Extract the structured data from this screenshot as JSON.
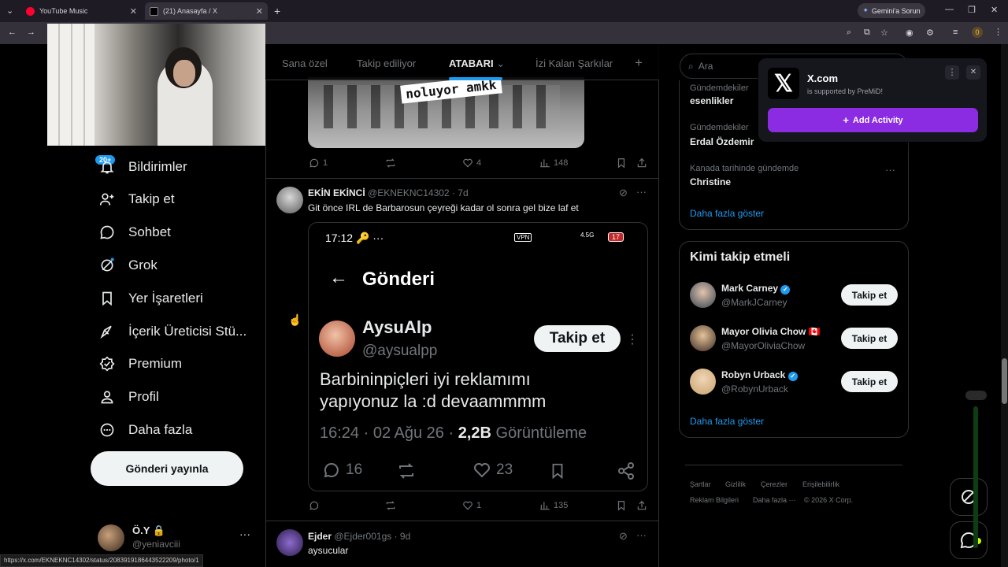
{
  "browser": {
    "tabs": [
      {
        "title": "YouTube Music",
        "active": false
      },
      {
        "title": "(21) Anasayfa / X",
        "active": true
      }
    ],
    "gemini_label": "Gemini'a Sorun",
    "extension_badge": "0",
    "status_url": "https://x.com/EKNEKNC14302/status/2083919186443522209/photo/1"
  },
  "nav": {
    "badge": "20+",
    "items": [
      {
        "label": "Bildirimler",
        "icon": "bell-icon"
      },
      {
        "label": "Takip et",
        "icon": "follow-icon"
      },
      {
        "label": "Sohbet",
        "icon": "chat-icon"
      },
      {
        "label": "Grok",
        "icon": "grok-icon"
      },
      {
        "label": "Yer İşaretleri",
        "icon": "bookmark-icon"
      },
      {
        "label": "İçerik Üreticisi Stü...",
        "icon": "creator-studio-icon"
      },
      {
        "label": "Premium",
        "icon": "premium-icon"
      },
      {
        "label": "Profil",
        "icon": "profile-icon"
      },
      {
        "label": "Daha fazla",
        "icon": "more-icon"
      }
    ],
    "post_button": "Gönderi yayınla",
    "account": {
      "name": "Ö.Y",
      "handle": "@yeniavciii"
    }
  },
  "timeline": {
    "tabs": [
      "Sana özel",
      "Takip ediliyor",
      "ATABARI",
      "İzi Kalan Şarkılar"
    ],
    "active_tab": "ATABARI",
    "post0": {
      "media_caption": "noluyor amkk",
      "replies": "1",
      "likes": "4",
      "views": "148"
    },
    "post1": {
      "name": "EKİN EKİNCİ",
      "handle": "@EKNEKNC14302",
      "time": "· 7d",
      "text": "Git önce IRL de Barbarosun çeyreği kadar ol sonra gel bize laf et",
      "likes": "1",
      "views": "135",
      "screenshot": {
        "clock": "17:12",
        "title": "Gönderi",
        "name": "AysuAlp",
        "handle": "@aysualpp",
        "follow": "Takip et",
        "text_line1": "Barbininpiçleri iyi reklamımı",
        "text_line2": "yapıyonuz la :d devaammmm",
        "meta": "16:24 · 02 Ağu 26 ·",
        "views_count": "2,2B",
        "views_label": "Görüntüleme",
        "replies": "16",
        "likes": "23",
        "status_icons": "VPN",
        "network": "4.5G",
        "battery": "17"
      }
    },
    "post2": {
      "name": "Ejder",
      "handle": "@Ejder001gs",
      "time": "· 9d",
      "text": "aysucular"
    }
  },
  "sidebar": {
    "search_placeholder": "Ara",
    "trends": [
      {
        "label": "Gündemdekiler",
        "title": "esenlikler"
      },
      {
        "label": "Gündemdekiler",
        "title": "Erdal Özdemir"
      },
      {
        "label": "Kanada tarihinde gündemde",
        "title": "Christine"
      }
    ],
    "show_more": "Daha fazla göster",
    "who_to_follow_title": "Kimi takip etmeli",
    "suggestions": [
      {
        "name": "Mark Carney",
        "handle": "@MarkJCarney",
        "verified": true
      },
      {
        "name": "Mayor Olivia Chow",
        "handle": "@MayorOliviaChow",
        "flag": "🇨🇦"
      },
      {
        "name": "Robyn Urback",
        "handle": "@RobynUrback",
        "verified": true
      }
    ],
    "follow_label": "Takip et",
    "show_more_2": "Daha fazla göster",
    "footer": [
      "Şartlar",
      "Gizlilik",
      "Çerezler",
      "Erişilebilirlik",
      "Reklam Bilgileri",
      "Daha fazla ···",
      "© 2026 X Corp."
    ]
  },
  "popup": {
    "title": "X.com",
    "subtitle": "is supported by PreMiD!",
    "button": "Add Activity"
  },
  "colors": {
    "accent": "#1d9bf0",
    "premid": "#8b2be2",
    "background": "#000000"
  }
}
